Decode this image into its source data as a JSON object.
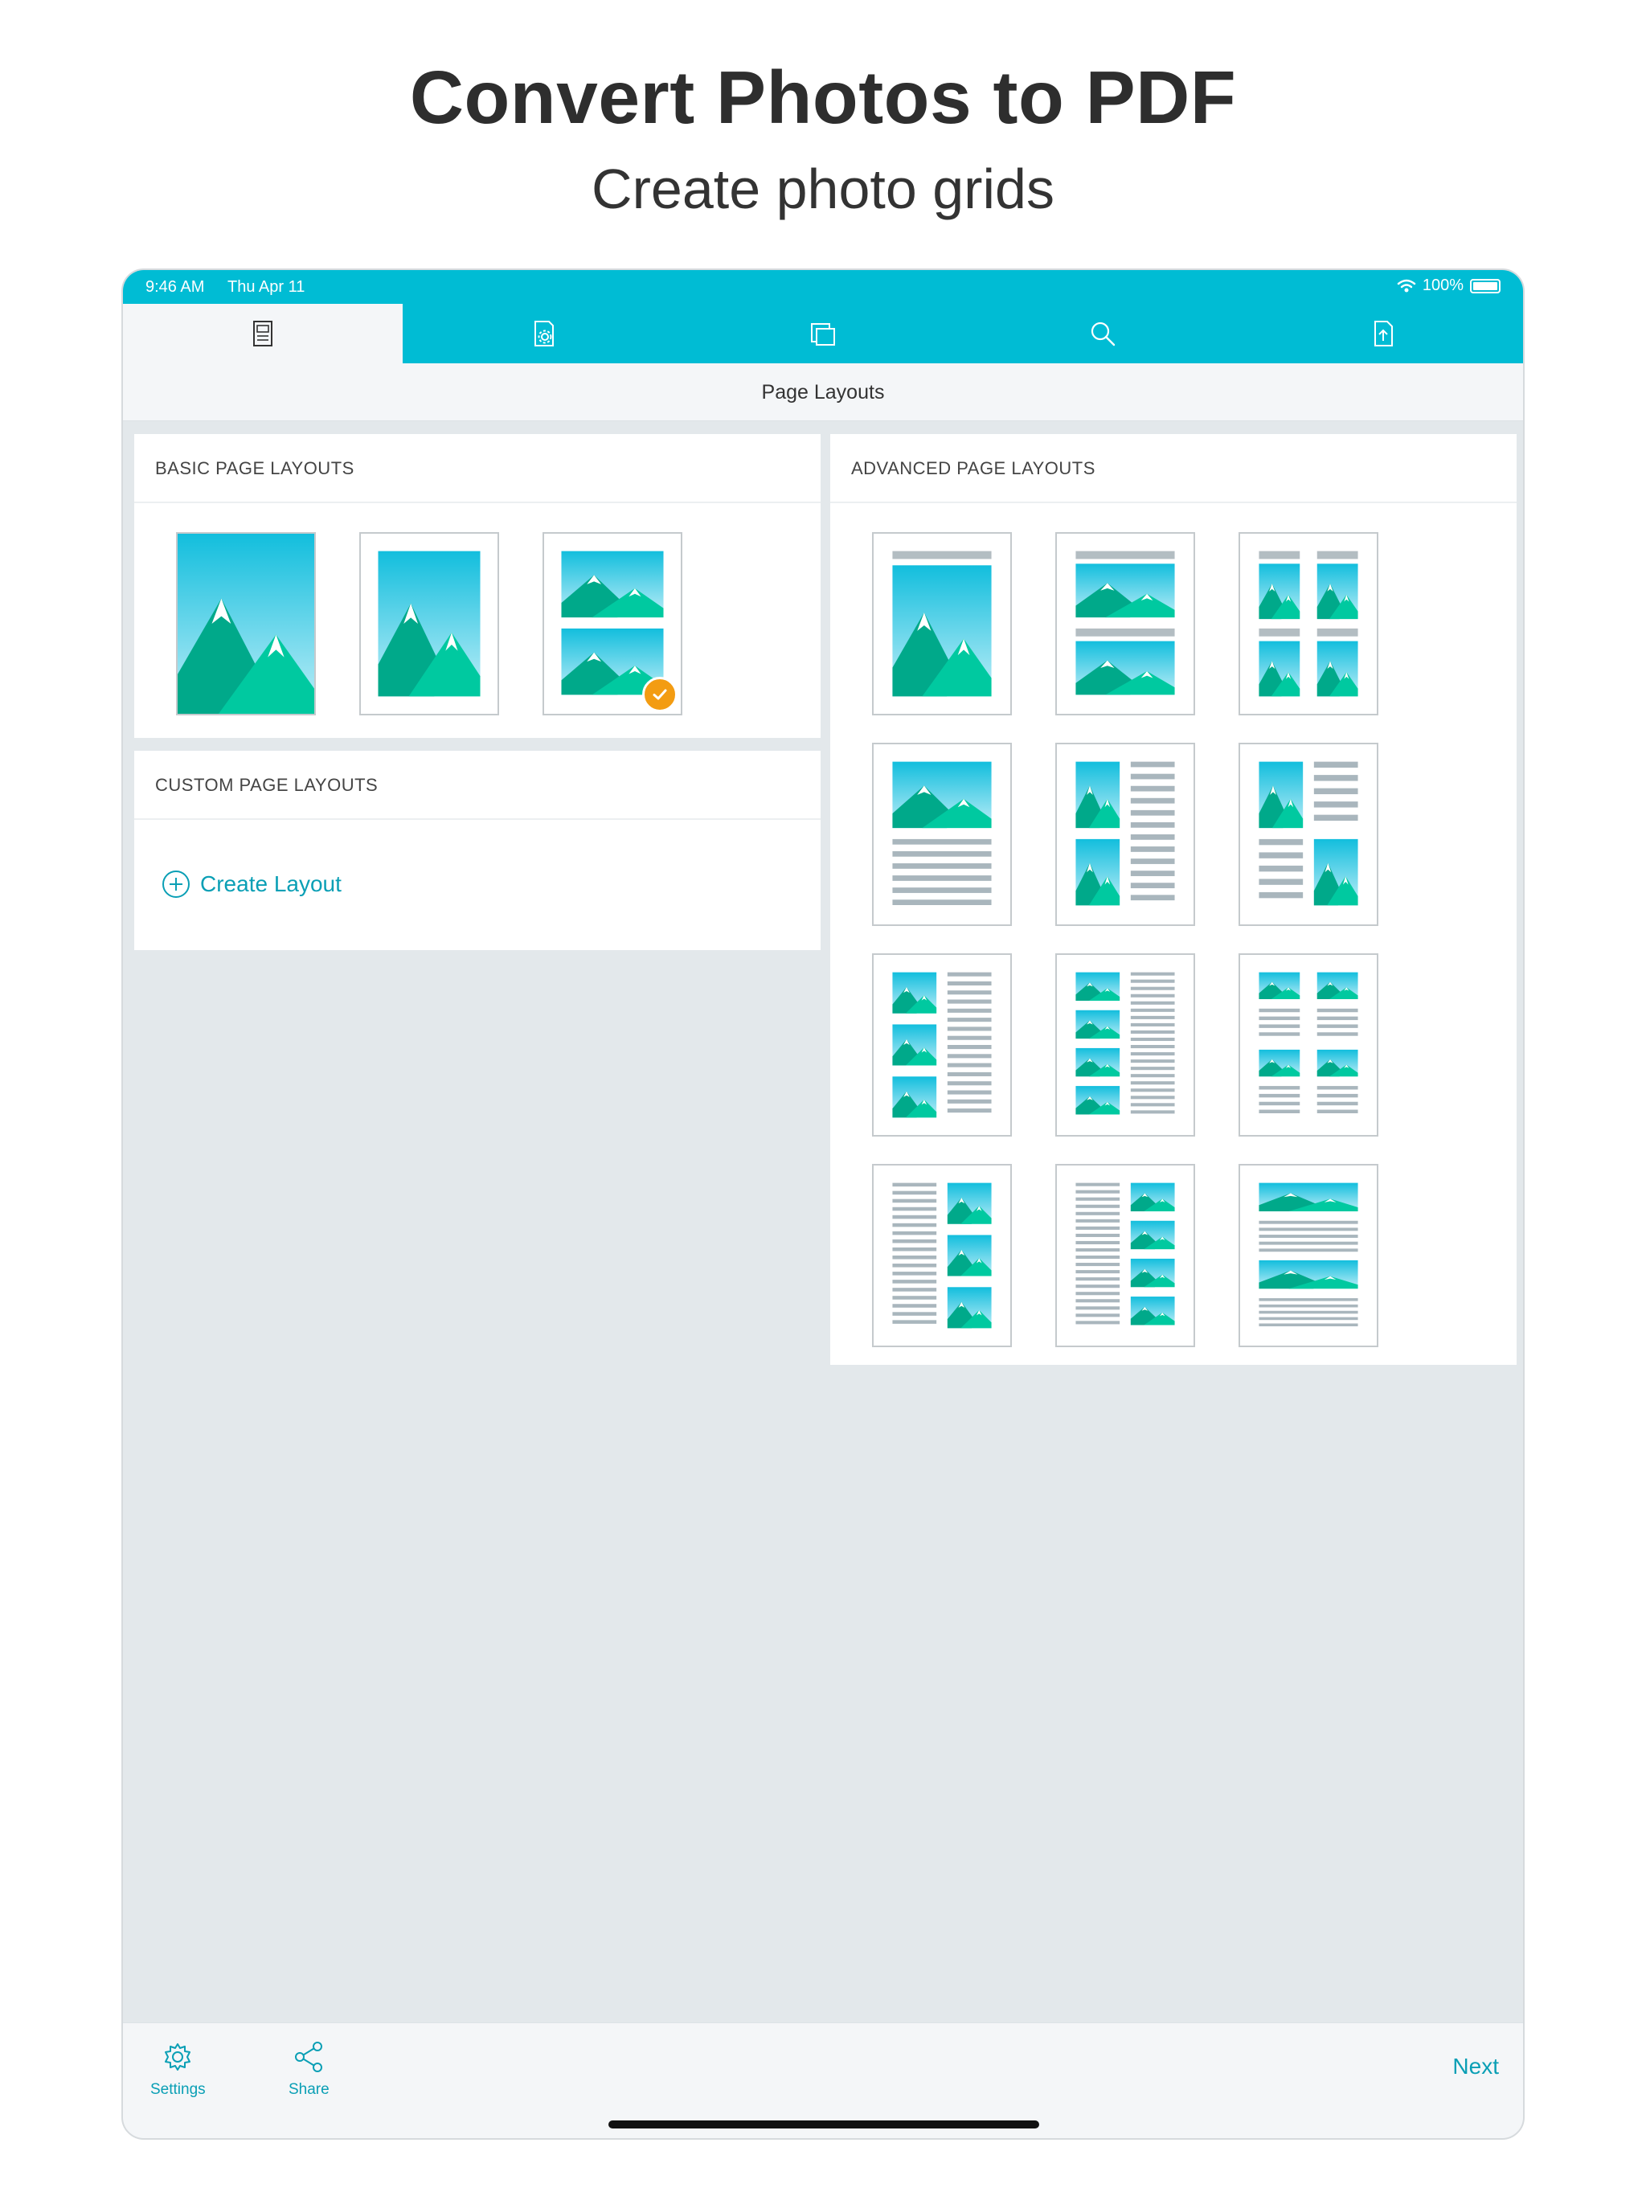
{
  "hero": {
    "title": "Convert Photos to PDF",
    "subtitle": "Create photo grids"
  },
  "status_bar": {
    "time": "9:46 AM",
    "date": "Thu Apr 11",
    "battery": "100%"
  },
  "tabs": [
    {
      "icon": "page-layout-icon",
      "active": true
    },
    {
      "icon": "page-settings-icon",
      "active": false
    },
    {
      "icon": "pages-icon",
      "active": false
    },
    {
      "icon": "search-icon",
      "active": false
    },
    {
      "icon": "export-icon",
      "active": false
    }
  ],
  "nav": {
    "title": "Page Layouts"
  },
  "basic": {
    "header": "BASIC PAGE LAYOUTS",
    "selected_index": 2
  },
  "custom": {
    "header": "CUSTOM PAGE LAYOUTS",
    "create_label": "Create Layout"
  },
  "advanced": {
    "header": "ADVANCED PAGE LAYOUTS"
  },
  "bottom_bar": {
    "settings_label": "Settings",
    "share_label": "Share",
    "next_label": "Next"
  },
  "colors": {
    "accent": "#00bcd4",
    "link": "#0a9fb5",
    "selected_badge": "#f39c12",
    "mountain_dark": "#00a98a",
    "mountain_light": "#00c9a0",
    "text_line": "#a9b6bd"
  }
}
